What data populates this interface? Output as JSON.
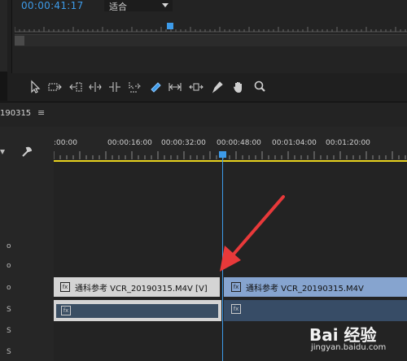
{
  "monitor": {
    "timecode": "00:00:41:17",
    "fit_select_value": "适合"
  },
  "toolbar": {
    "tools": [
      {
        "name": "selection-tool-icon"
      },
      {
        "name": "track-select-tool-icon"
      },
      {
        "name": "ripple-edit-tool-icon"
      },
      {
        "name": "rolling-edit-tool-icon"
      },
      {
        "name": "rate-stretch-tool-icon"
      },
      {
        "name": "razor-select-tool-icon"
      },
      {
        "name": "razor-tool-icon"
      },
      {
        "name": "slip-tool-icon"
      },
      {
        "name": "slide-tool-icon"
      },
      {
        "name": "pen-tool-icon"
      },
      {
        "name": "hand-tool-icon"
      },
      {
        "name": "zoom-tool-icon"
      }
    ]
  },
  "timeline": {
    "sequence_name": "190315",
    "menu_glyph": "≡",
    "ruler_ticks": [
      ":00:00",
      "00:00:16:00",
      "00:00:32:00",
      "00:00:48:00",
      "00:01:04:00",
      "00:01:20:00"
    ],
    "track_letters": [
      "o",
      "o",
      "o",
      "S",
      "S",
      "S"
    ],
    "clips": {
      "v1_label": "通科参考 VCR_20190315.M4V [V]",
      "v2_label": "通科参考 VCR_20190315.M4V",
      "fx": "fx"
    }
  },
  "watermark": {
    "text": "Bai 经验",
    "url": "jingyan.baidu.com"
  },
  "colors": {
    "accent": "#3d9be9",
    "ruler_bar": "#e8d21e",
    "annotation_arrow": "#e8393a"
  }
}
